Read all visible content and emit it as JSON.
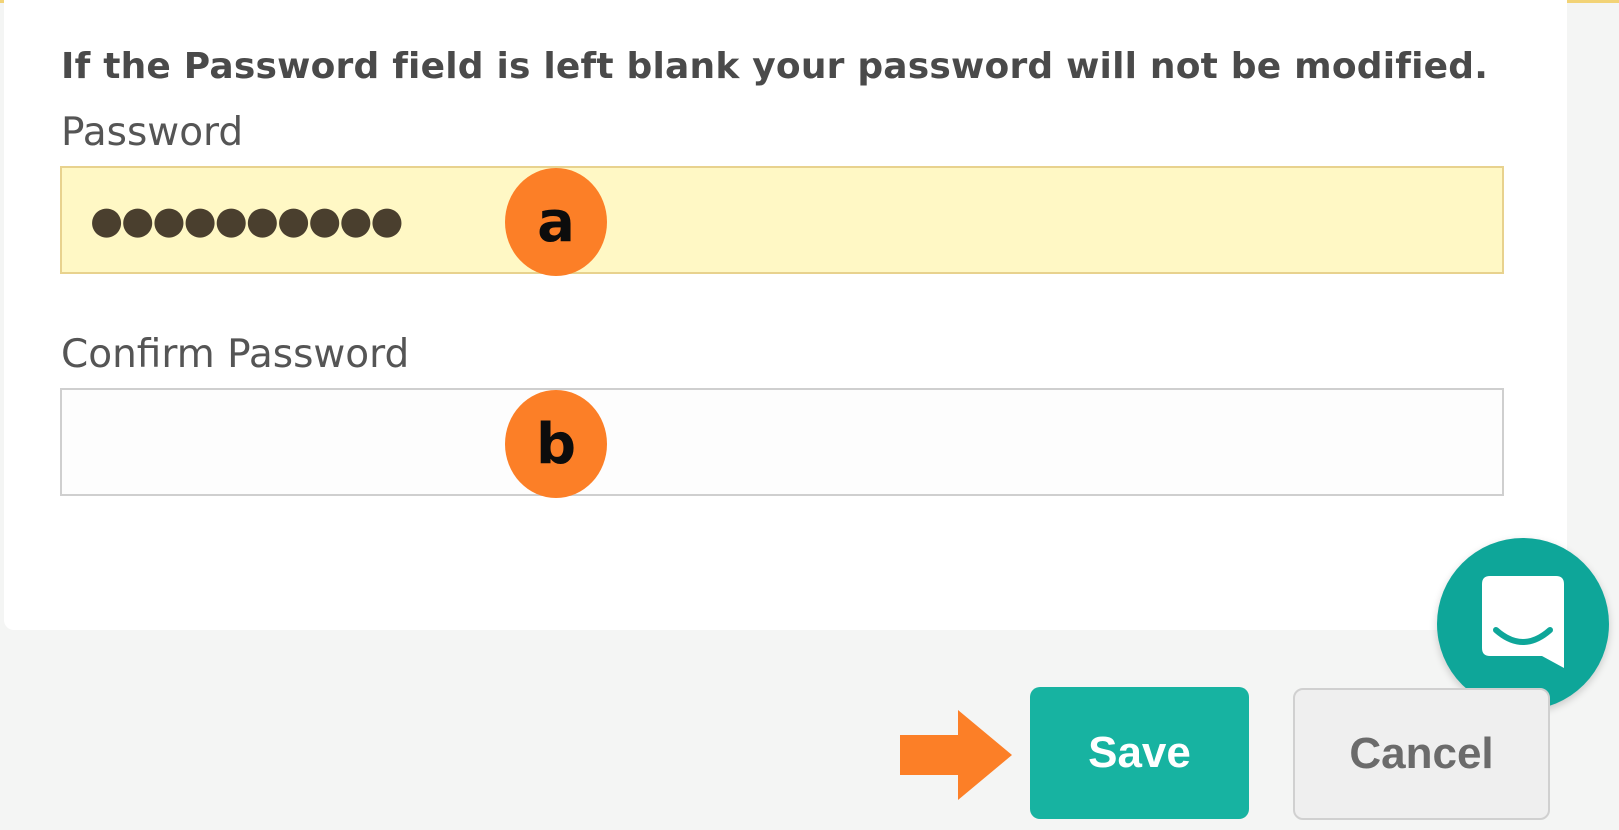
{
  "form": {
    "notice": "If the Password field is left blank your password will not be modified.",
    "password": {
      "label": "Password",
      "masked_value": "●●●●●●●●●●"
    },
    "confirm_password": {
      "label": "Confirm Password",
      "value": ""
    }
  },
  "annotations": {
    "marker_a": "a",
    "marker_b": "b",
    "arrow_icon": "right-arrow-icon"
  },
  "actions": {
    "save_label": "Save",
    "cancel_label": "Cancel"
  },
  "chat_widget": {
    "icon": "chat-bubble-icon"
  },
  "colors": {
    "accent_teal": "#17b3a1",
    "chat_teal": "#0ea699",
    "annotation_orange": "#fc7f27",
    "password_fill": "#fff8c5"
  }
}
